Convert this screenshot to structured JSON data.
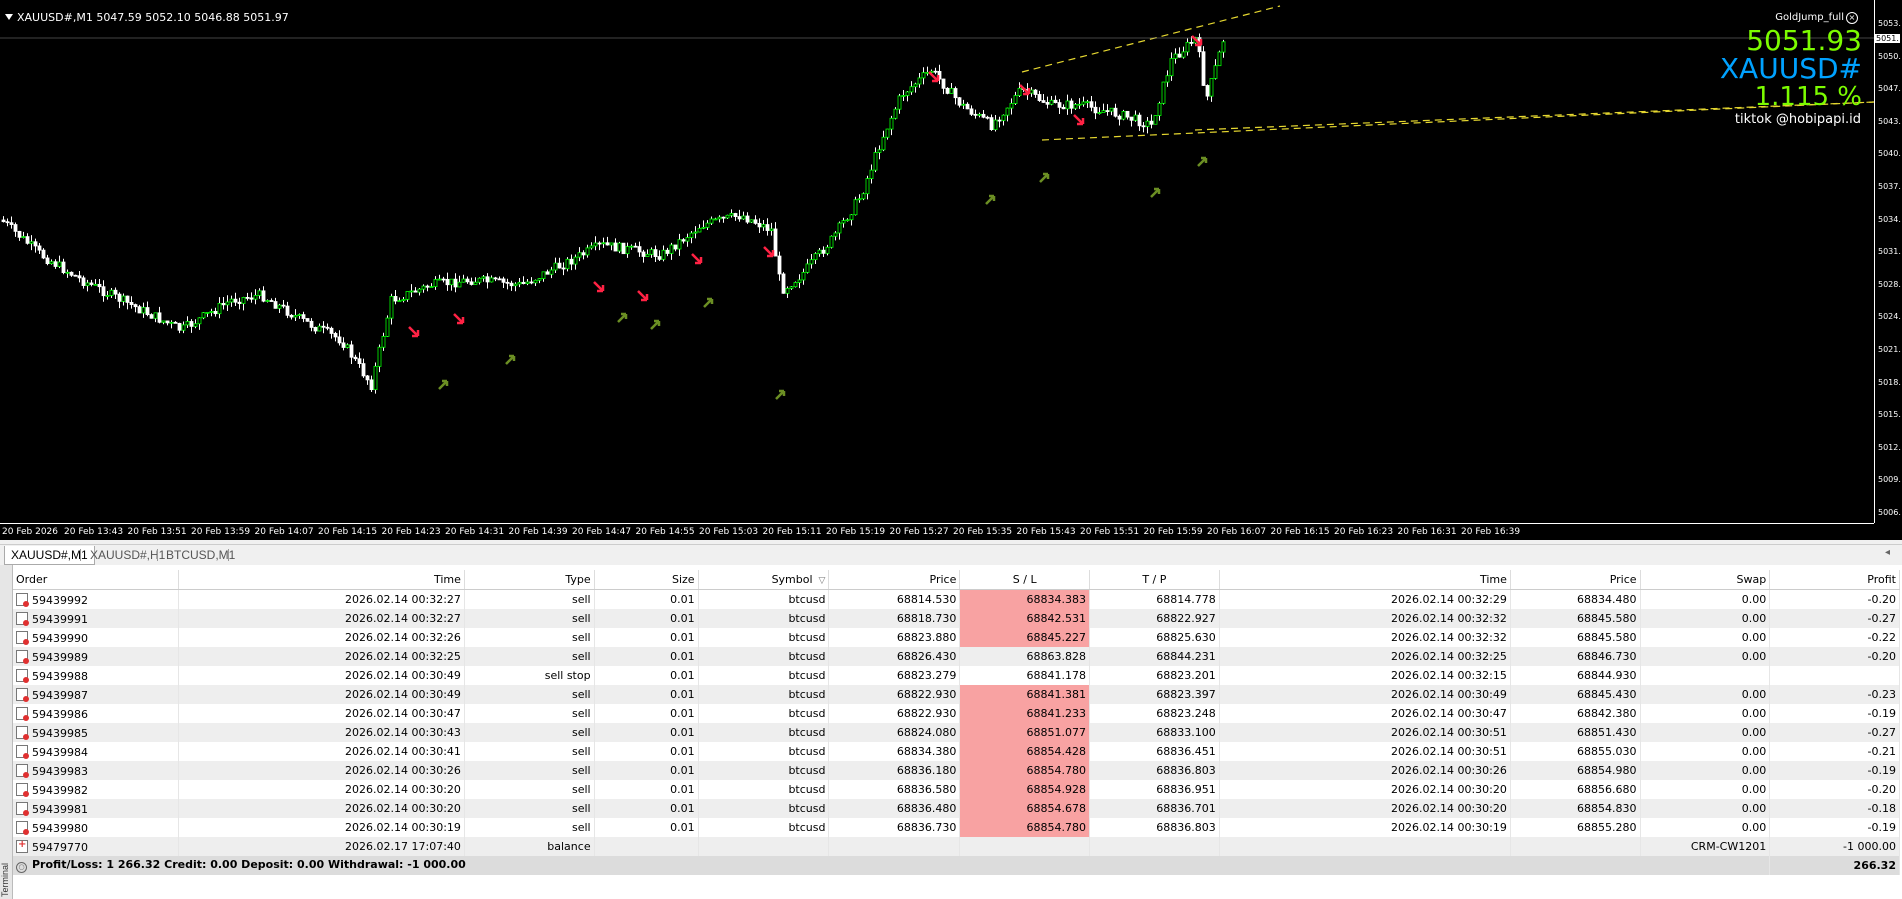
{
  "chart": {
    "symbol_info": "XAUUSD#,M1  5047.59 5052.10 5046.88 5051.97",
    "ea_name": "GoldJump_full",
    "overlay": {
      "price": "5051.93",
      "symbol": "XAUUSD#",
      "percent": "1.115 %",
      "tiktok": "tiktok @hobipapi.id"
    },
    "current_price_tag": "5051.",
    "price_labels": [
      "5053.",
      "5050.",
      "5047.",
      "5043.",
      "5040.",
      "5037.",
      "5034.",
      "5031.",
      "5028.",
      "5024.",
      "5021.",
      "5018.",
      "5015.",
      "5012.",
      "5009.",
      "5006."
    ],
    "time_labels": [
      "20 Feb 2026",
      "20 Feb 13:43",
      "20 Feb 13:51",
      "20 Feb 13:59",
      "20 Feb 14:07",
      "20 Feb 14:15",
      "20 Feb 14:23",
      "20 Feb 14:31",
      "20 Feb 14:39",
      "20 Feb 14:47",
      "20 Feb 14:55",
      "20 Feb 15:03",
      "20 Feb 15:11",
      "20 Feb 15:19",
      "20 Feb 15:27",
      "20 Feb 15:35",
      "20 Feb 15:43",
      "20 Feb 15:51",
      "20 Feb 15:59",
      "20 Feb 16:07",
      "20 Feb 16:15",
      "20 Feb 16:23",
      "20 Feb 16:31",
      "20 Feb 16:39"
    ],
    "colors": {
      "background": "#000000",
      "bull": "#00ff00",
      "bear": "#ffffff",
      "sell_arrow": "#ff2244",
      "buy_arrow": "#6b8e23",
      "trendline": "#e6d830"
    }
  },
  "chart_tabs": [
    "XAUUSD#,M1",
    "XAUUSD#,H1",
    "BTCUSD,M1"
  ],
  "table": {
    "columns": [
      "Order",
      "Time",
      "Type",
      "Size",
      "Symbol",
      "Price",
      "S / L",
      "T / P",
      "Time",
      "Price",
      "Swap",
      "Profit"
    ],
    "rows": [
      [
        "59439992",
        "2026.02.14 00:32:27",
        "sell",
        "0.01",
        "btcusd",
        "68814.530",
        "68834.383",
        "68814.778",
        "2026.02.14 00:32:29",
        "68834.480",
        "0.00",
        "-0.20"
      ],
      [
        "59439991",
        "2026.02.14 00:32:27",
        "sell",
        "0.01",
        "btcusd",
        "68818.730",
        "68842.531",
        "68822.927",
        "2026.02.14 00:32:32",
        "68845.580",
        "0.00",
        "-0.27"
      ],
      [
        "59439990",
        "2026.02.14 00:32:26",
        "sell",
        "0.01",
        "btcusd",
        "68823.880",
        "68845.227",
        "68825.630",
        "2026.02.14 00:32:32",
        "68845.580",
        "0.00",
        "-0.22"
      ],
      [
        "59439989",
        "2026.02.14 00:32:25",
        "sell",
        "0.01",
        "btcusd",
        "68826.430",
        "68863.828",
        "68844.231",
        "2026.02.14 00:32:25",
        "68846.730",
        "0.00",
        "-0.20"
      ],
      [
        "59439988",
        "2026.02.14 00:30:49",
        "sell stop",
        "0.01",
        "btcusd",
        "68823.279",
        "68841.178",
        "68823.201",
        "2026.02.14 00:32:15",
        "68844.930",
        "",
        ""
      ],
      [
        "59439987",
        "2026.02.14 00:30:49",
        "sell",
        "0.01",
        "btcusd",
        "68822.930",
        "68841.381",
        "68823.397",
        "2026.02.14 00:30:49",
        "68845.430",
        "0.00",
        "-0.23"
      ],
      [
        "59439986",
        "2026.02.14 00:30:47",
        "sell",
        "0.01",
        "btcusd",
        "68822.930",
        "68841.233",
        "68823.248",
        "2026.02.14 00:30:47",
        "68842.380",
        "0.00",
        "-0.19"
      ],
      [
        "59439985",
        "2026.02.14 00:30:43",
        "sell",
        "0.01",
        "btcusd",
        "68824.080",
        "68851.077",
        "68833.100",
        "2026.02.14 00:30:51",
        "68851.430",
        "0.00",
        "-0.27"
      ],
      [
        "59439984",
        "2026.02.14 00:30:41",
        "sell",
        "0.01",
        "btcusd",
        "68834.380",
        "68854.428",
        "68836.451",
        "2026.02.14 00:30:51",
        "68855.030",
        "0.00",
        "-0.21"
      ],
      [
        "59439983",
        "2026.02.14 00:30:26",
        "sell",
        "0.01",
        "btcusd",
        "68836.180",
        "68854.780",
        "68836.803",
        "2026.02.14 00:30:26",
        "68854.980",
        "0.00",
        "-0.19"
      ],
      [
        "59439982",
        "2026.02.14 00:30:20",
        "sell",
        "0.01",
        "btcusd",
        "68836.580",
        "68854.928",
        "68836.951",
        "2026.02.14 00:30:20",
        "68856.680",
        "0.00",
        "-0.20"
      ],
      [
        "59439981",
        "2026.02.14 00:30:20",
        "sell",
        "0.01",
        "btcusd",
        "68836.480",
        "68854.678",
        "68836.701",
        "2026.02.14 00:30:20",
        "68854.830",
        "0.00",
        "-0.18"
      ],
      [
        "59439980",
        "2026.02.14 00:30:19",
        "sell",
        "0.01",
        "btcusd",
        "68836.730",
        "68854.780",
        "68836.803",
        "2026.02.14 00:30:19",
        "68855.280",
        "0.00",
        "-0.19"
      ]
    ],
    "sl_highlight": [
      true,
      true,
      true,
      false,
      false,
      true,
      true,
      true,
      true,
      true,
      true,
      true,
      true
    ],
    "balance_row": {
      "order": "59479770",
      "time": "2026.02.17 17:07:40",
      "type": "balance",
      "comment": "CRM-CW1201",
      "profit": "-1 000.00"
    },
    "summary": {
      "text": "Profit/Loss: 1 266.32  Credit: 0.00  Deposit: 0.00  Withdrawal: -1 000.00",
      "total": "266.32"
    }
  },
  "side_label": "Terminal"
}
